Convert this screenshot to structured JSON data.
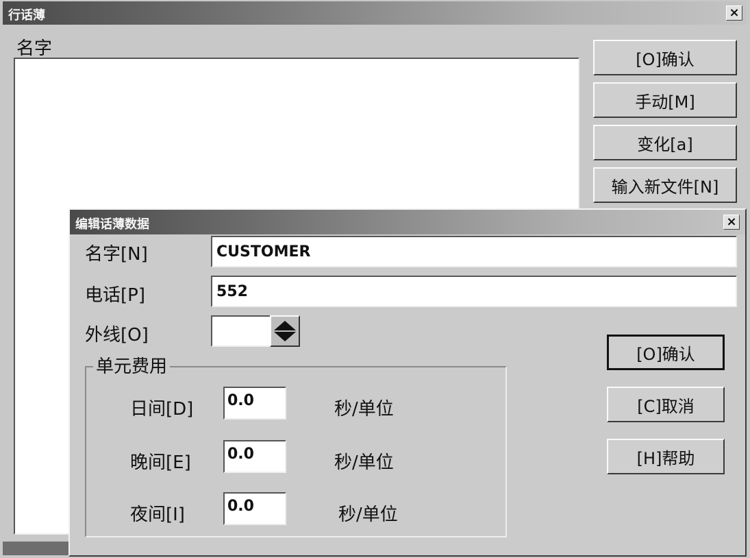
{
  "main_window": {
    "title": "行话薄",
    "close": "×",
    "name_label": "名字",
    "buttons": {
      "confirm": "[O]确认",
      "manual": "手动[M]",
      "change": "变化[a]",
      "new_file": "输入新文件[N]"
    }
  },
  "edit_dialog": {
    "title": "编辑话薄数据",
    "close": "×",
    "name_label": "名字[N]",
    "name_value": "CUSTOMER",
    "phone_label": "电话[P]",
    "phone_value": "552",
    "outline_label": "外线[O]",
    "outline_value": "",
    "group_label": "单元费用",
    "rows": [
      {
        "label": "日间[D]",
        "value": "0.0",
        "unit": "秒/单位"
      },
      {
        "label": "晚间[E]",
        "value": "0.0",
        "unit": "秒/单位"
      },
      {
        "label": "夜间[I]",
        "value": "0.0",
        "unit": "秒/单位"
      }
    ],
    "buttons": {
      "confirm": "[O]确认",
      "cancel": "[C]取消",
      "help": "[H]帮助"
    }
  }
}
